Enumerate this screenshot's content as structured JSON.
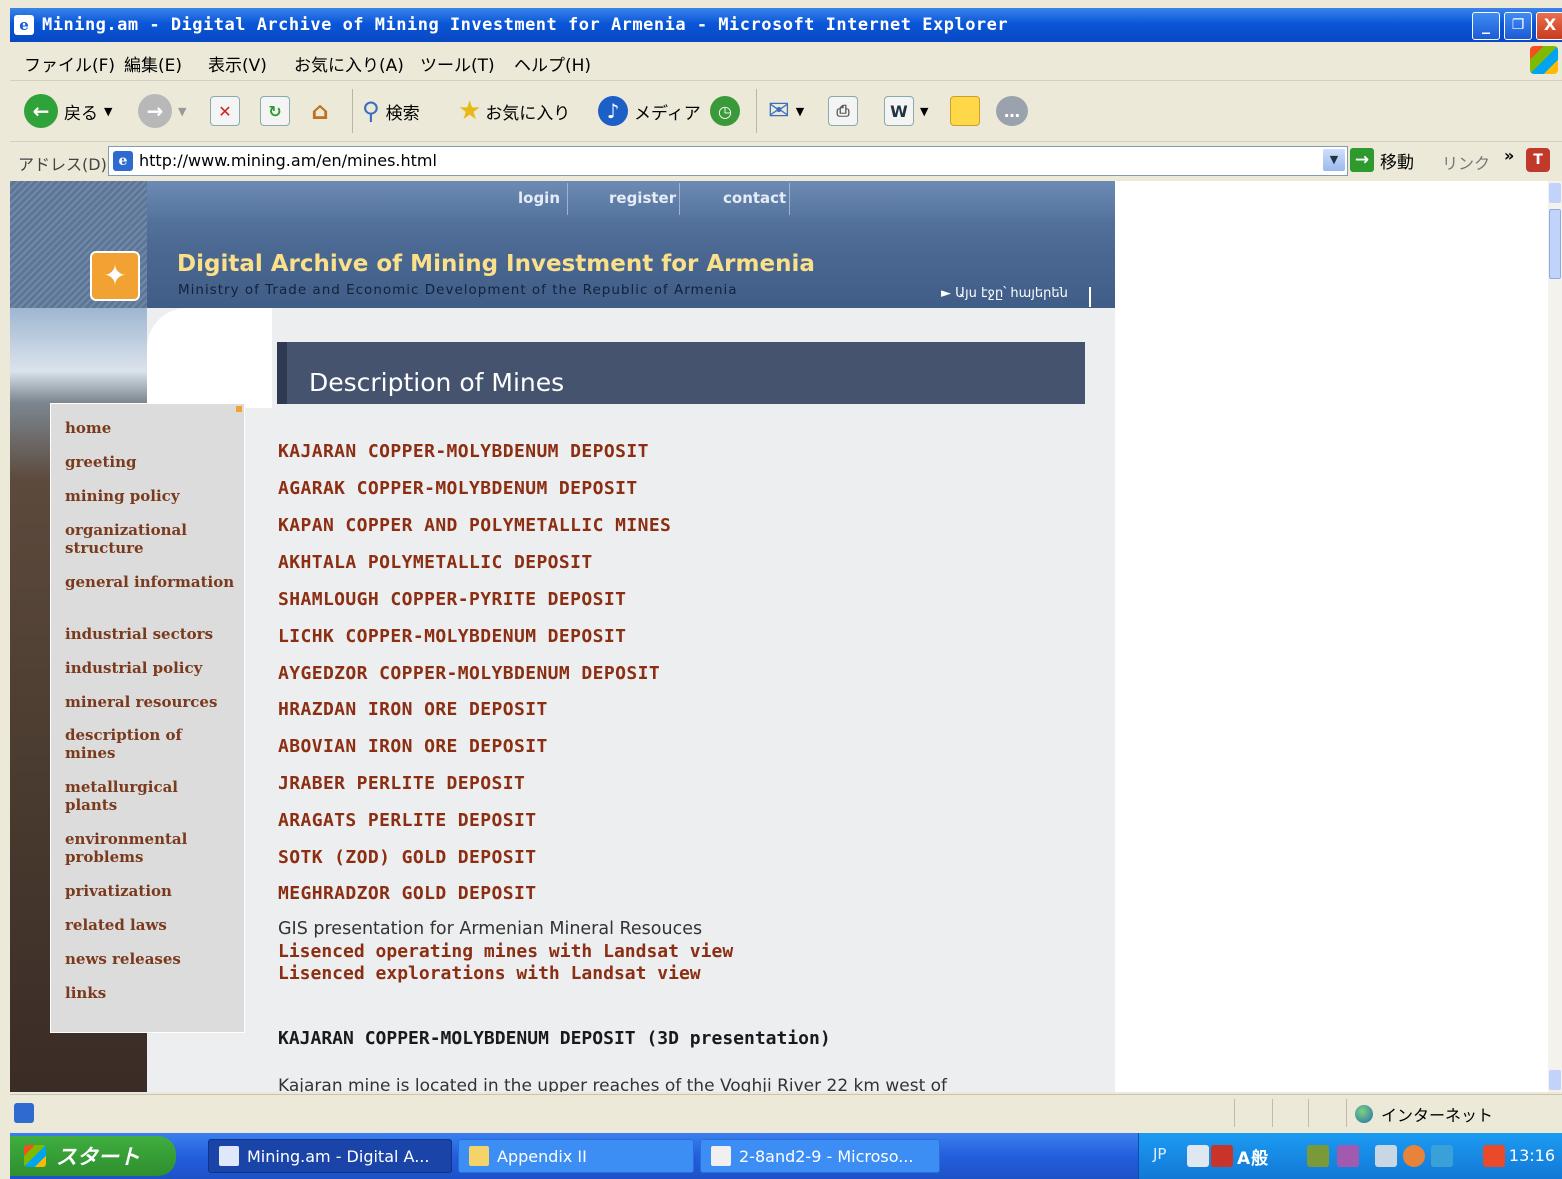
{
  "window": {
    "title": "Mining.am - Digital Archive of Mining Investment for Armenia - Microsoft Internet Explorer",
    "min": "_",
    "max": "❐",
    "close": "X"
  },
  "menubar": [
    "ファイル(F)",
    "編集(E)",
    "表示(V)",
    "お気に入り(A)",
    "ツール(T)",
    "ヘルプ(H)"
  ],
  "toolbar": {
    "back": "戻る",
    "search": "検索",
    "favorites": "お気に入り",
    "media": "メディア"
  },
  "address": {
    "label": "アドレス(D)",
    "url": "http://www.mining.am/en/mines.html",
    "go": "移動",
    "links": "リンク",
    "more": "»"
  },
  "site": {
    "top_links": [
      "login",
      "register",
      "contact"
    ],
    "title": "Digital Archive of Mining Investment for Armenia",
    "subtitle": "Ministry of Trade and Economic Development of the Republic of Armenia",
    "arm_link": "► Այս էջը՝ հայերեն",
    "nav": [
      "home",
      "greeting",
      "mining policy",
      "organizational structure",
      "general information",
      "industrial sectors",
      "industrial policy",
      "mineral resources",
      "description of mines",
      "metallurgical plants",
      "environmental problems",
      "privatization",
      "related laws",
      "news releases",
      "links"
    ],
    "section_title": "Description of Mines",
    "mines": [
      "KAJARAN COPPER-MOLYBDENUM DEPOSIT",
      "AGARAK COPPER-MOLYBDENUM DEPOSIT",
      "KAPAN COPPER AND POLYMETALLIC MINES",
      "AKHTALA POLYMETALLIC DEPOSIT",
      "SHAMLOUGH COPPER-PYRITE DEPOSIT",
      "LICHK COPPER-MOLYBDENUM DEPOSIT",
      "AYGEDZOR COPPER-MOLYBDENUM DEPOSIT",
      "HRAZDAN IRON ORE DEPOSIT",
      "ABOVIAN IRON ORE DEPOSIT",
      "JRABER PERLITE DEPOSIT",
      "ARAGATS PERLITE DEPOSIT",
      "SOTK (ZOD) GOLD DEPOSIT",
      "MEGHRADZOR GOLD DEPOSIT"
    ],
    "gis_text": "GIS presentation for Armenian Mineral Resouces",
    "gis_links": [
      "Lisenced operating mines with Landsat view",
      "Lisenced explorations with Landsat view"
    ],
    "kajaran_3d": "KAJARAN COPPER-MOLYBDENUM DEPOSIT (3D presentation)",
    "cut_text": "Kajaran mine is located in the upper reaches of the Voghji River 22 km west of"
  },
  "status": {
    "zone": "インターネット"
  },
  "taskbar": {
    "start": "スタート",
    "tasks": [
      "Mining.am - Digital A...",
      "Appendix II",
      "2-8and2-9 - Microso..."
    ],
    "lang": "JP",
    "ime": "A般",
    "clock": "13:16"
  },
  "colors": {
    "link": "#8b2e12",
    "banner": "#46536e",
    "header_title": "#fbe08a",
    "nav_text": "#7a3a1d"
  },
  "icons": [
    "ie-icon",
    "back-icon",
    "forward-icon",
    "stop-icon",
    "refresh-icon",
    "home-icon",
    "search-icon",
    "favorites-icon",
    "media-icon",
    "history-icon",
    "mail-icon",
    "print-icon",
    "edit-icon",
    "notes-icon",
    "messenger-icon",
    "go-icon",
    "translate-icon",
    "globe-icon",
    "windows-flag-icon",
    "folder-icon",
    "word-icon",
    "clock-icon"
  ]
}
